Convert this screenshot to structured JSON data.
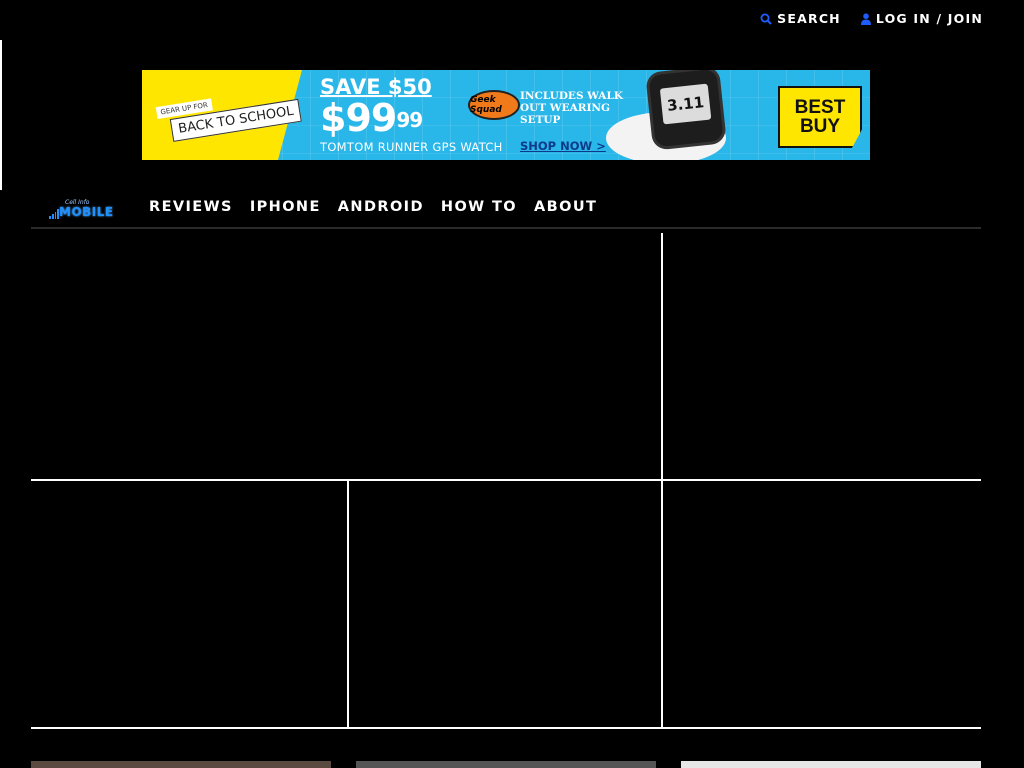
{
  "topbar": {
    "search_label": "SEARCH",
    "login_label": "LOG IN / JOIN",
    "icon_color": "#1e5cff"
  },
  "ad": {
    "gear_up": "GEAR UP FOR",
    "back_to_school": "BACK TO SCHOOL",
    "save": "SAVE $50",
    "price_dollars": "$99",
    "price_cents": "99",
    "product": "TOMTOM RUNNER GPS WATCH",
    "cta": "SHOP NOW >",
    "geek_squad": "Geek Squad",
    "includes": "INCLUDES WALK OUT WEARING SETUP",
    "watch_display": "3.11",
    "brand": "BEST BUY"
  },
  "nav": {
    "logo_small": "Cell Info",
    "logo_big": "MOBILE",
    "items": [
      "REVIEWS",
      "IPHONE",
      "ANDROID",
      "HOW TO",
      "ABOUT"
    ]
  },
  "colors": {
    "background": "#000000",
    "divider": "#ffffff",
    "ad_blue": "#29b6e8",
    "ad_yellow": "#ffe600",
    "logo_blue": "#1e90ff"
  }
}
